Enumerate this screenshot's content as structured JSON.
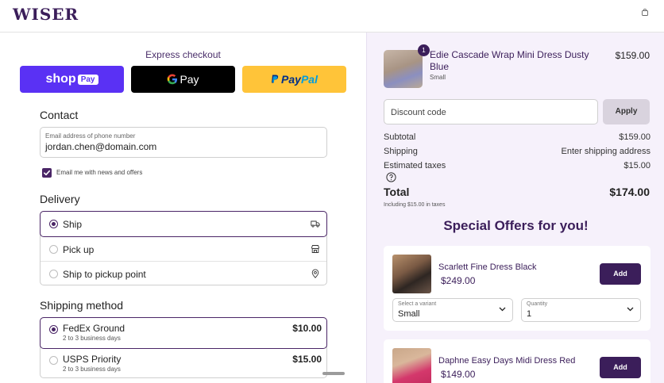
{
  "header": {
    "logo": "WISER",
    "cart_icon": "shopping-bag-icon"
  },
  "express": {
    "title": "Express checkout",
    "shop_label": "shop",
    "shop_pay_tag": "Pay",
    "gpay_label": "Pay",
    "paypal_part1": "Pay",
    "paypal_part2": "Pal"
  },
  "contact": {
    "title": "Contact",
    "email_label": "Email address of phone number",
    "email_value": "jordan.chen@domain.com",
    "news_checked": true,
    "news_label": "Email me with news and offers"
  },
  "delivery": {
    "title": "Delivery",
    "options": [
      {
        "label": "Ship",
        "selected": true,
        "icon": "truck-icon"
      },
      {
        "label": "Pick up",
        "selected": false,
        "icon": "store-icon"
      },
      {
        "label": "Ship to pickup point",
        "selected": false,
        "icon": "map-pin-icon"
      }
    ]
  },
  "shipping": {
    "title": "Shipping method",
    "options": [
      {
        "name": "FedEx Ground",
        "sub": "2 to 3 business days",
        "price": "$10.00",
        "selected": true
      },
      {
        "name": "USPS Priority",
        "sub": "2 to 3 business days",
        "price": "$15.00",
        "selected": false
      }
    ]
  },
  "cart": {
    "item": {
      "quantity": "1",
      "name": "Edie Cascade Wrap Mini Dress Dusty Blue",
      "variant": "Small",
      "price": "$159.00"
    },
    "discount_placeholder": "Discount code",
    "apply_label": "Apply",
    "summary": {
      "subtotal_label": "Subtotal",
      "subtotal": "$159.00",
      "shipping_label": "Shipping",
      "shipping": "Enter shipping address",
      "taxes_label": "Estimated taxes",
      "taxes": "$15.00",
      "total_label": "Total",
      "total": "$174.00",
      "tax_note": "Including $15.00 in taxes"
    }
  },
  "offers": {
    "title": "Special Offers for you!",
    "items": [
      {
        "name": "Scarlett Fine Dress Black",
        "price": "$249.00",
        "add_label": "Add",
        "variant_label": "Select a variant",
        "variant_value": "Small",
        "qty_label": "Quantity",
        "qty_value": "1"
      },
      {
        "name": "Daphne Easy Days Midi Dress Red",
        "price": "$149.00",
        "add_label": "Add"
      }
    ]
  },
  "colors": {
    "brand": "#3b1e5a",
    "accent": "#4a2566",
    "shop_pay": "#5a31f4",
    "paypal": "#ffc439",
    "summary_bg": "#f6f1fb"
  }
}
